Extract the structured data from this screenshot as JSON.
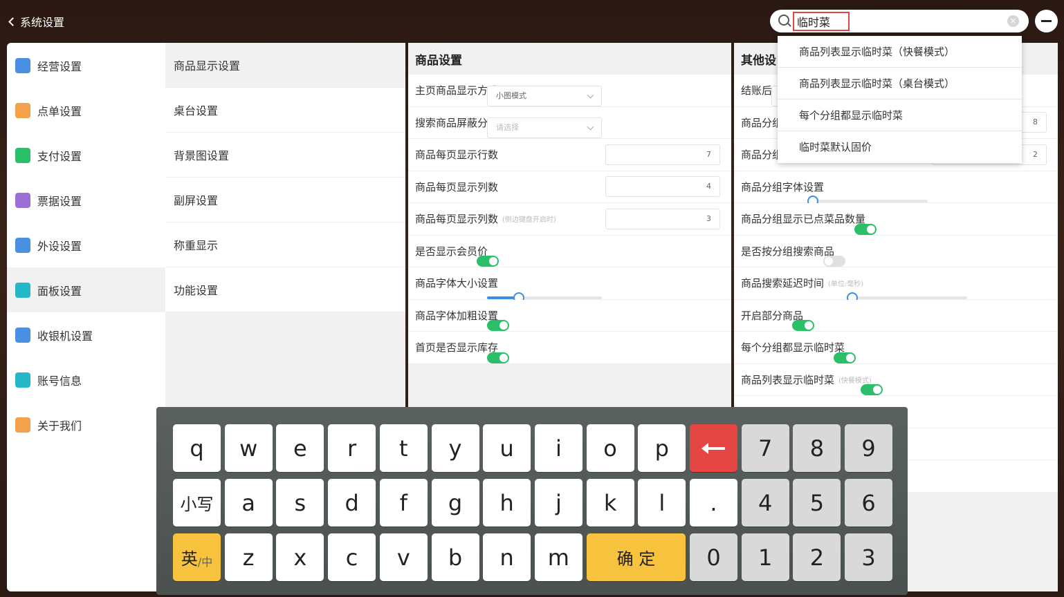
{
  "header": {
    "back_label": "系统设置",
    "search_value": "临时菜"
  },
  "search_suggestions": [
    "商品列表显示临时菜（快餐模式）",
    "商品列表显示临时菜（桌台模式）",
    "每个分组都显示临时菜",
    "临时菜默认固价"
  ],
  "left_nav": [
    {
      "label": "经营设置",
      "icon": "store-icon",
      "color": "#4a90e2"
    },
    {
      "label": "点单设置",
      "icon": "order-icon",
      "color": "#f5a04a"
    },
    {
      "label": "支付设置",
      "icon": "yen-icon",
      "color": "#2cbf6a"
    },
    {
      "label": "票据设置",
      "icon": "printer-icon",
      "color": "#9b6fd6"
    },
    {
      "label": "外设设置",
      "icon": "monitor-icon",
      "color": "#4a90e2"
    },
    {
      "label": "面板设置",
      "icon": "panel-icon",
      "color": "#23b7c7"
    },
    {
      "label": "收银机设置",
      "icon": "cashier-icon",
      "color": "#4a90e2"
    },
    {
      "label": "账号信息",
      "icon": "account-icon",
      "color": "#23b7c7"
    },
    {
      "label": "关于我们",
      "icon": "info-icon",
      "color": "#f5a04a"
    }
  ],
  "sub_nav": [
    "商品显示设置",
    "桌台设置",
    "背景图设置",
    "副屏设置",
    "称重显示",
    "功能设置"
  ],
  "middle_panel": {
    "title": "商品设置",
    "rows": [
      {
        "label": "主页商品显示方式",
        "type": "dropdown",
        "value": "小图模式"
      },
      {
        "label": "搜索商品屏蔽分组",
        "type": "dropdown",
        "placeholder": "请选择"
      },
      {
        "label": "商品每页显示行数",
        "type": "number",
        "value": "7"
      },
      {
        "label": "商品每页显示列数",
        "type": "number",
        "value": "4"
      },
      {
        "label": "商品每页显示列数",
        "hint": "(侧边键盘开启时)",
        "type": "number",
        "value": "3"
      },
      {
        "label": "是否显示会员价",
        "type": "toggle",
        "on": true
      },
      {
        "label": "商品字体大小设置",
        "type": "slider",
        "level": 0.28
      },
      {
        "label": "商品字体加粗设置",
        "type": "toggle",
        "on": true
      },
      {
        "label": "首页是否显示库存",
        "type": "toggle",
        "on": true
      }
    ]
  },
  "right_panel": {
    "title": "其他设",
    "rows": [
      {
        "label": "结账后显",
        "type": "dropdown",
        "value": ""
      },
      {
        "label": "商品分组",
        "type": "number",
        "value": "8"
      },
      {
        "label": "商品分组",
        "type": "number",
        "value": "2"
      },
      {
        "label": "商品分组字体设置",
        "type": "slider",
        "level": 0.0
      },
      {
        "label": "商品分组显示已点菜品数量",
        "type": "toggle",
        "on": true
      },
      {
        "label": "是否按分组搜索商品",
        "type": "toggle",
        "on": false
      },
      {
        "label": "商品搜索延迟时间",
        "hint": "(单位:毫秒)",
        "type": "slider",
        "level": 0.0
      },
      {
        "label": "开启部分商品",
        "type": "toggle",
        "on": true
      },
      {
        "label": "每个分组都显示临时菜",
        "type": "toggle",
        "on": true
      },
      {
        "label": "商品列表显示临时菜",
        "hint": "(快餐模式)",
        "type": "toggle",
        "on": true
      },
      {
        "label": "",
        "type": "toggle",
        "on": true
      },
      {
        "label": "",
        "type": "toggle",
        "on": false
      },
      {
        "label": "",
        "type": "toggle",
        "on": true
      }
    ]
  },
  "keyboard": {
    "row1": [
      "q",
      "w",
      "e",
      "r",
      "t",
      "y",
      "u",
      "i",
      "o",
      "p"
    ],
    "row2": [
      "小写",
      "a",
      "s",
      "d",
      "f",
      "g",
      "h",
      "j",
      "k",
      "l",
      "."
    ],
    "row3": [
      "z",
      "x",
      "c",
      "v",
      "b",
      "n",
      "m"
    ],
    "numpad_row1": [
      "7",
      "8",
      "9"
    ],
    "numpad_row2": [
      "4",
      "5",
      "6"
    ],
    "numpad_row3": [
      "0",
      "1",
      "2",
      "3"
    ],
    "lang_main": "英",
    "lang_sub": "/中",
    "confirm": "确 定"
  }
}
